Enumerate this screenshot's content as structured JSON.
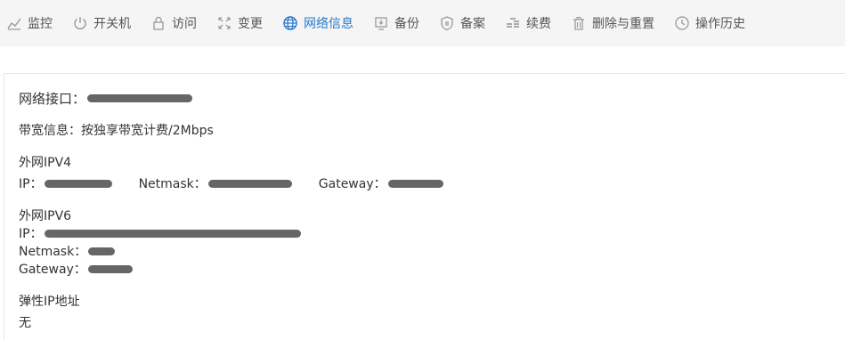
{
  "tabs": [
    {
      "id": "monitor",
      "label": "监控",
      "icon": "chart-line-icon"
    },
    {
      "id": "power",
      "label": "开关机",
      "icon": "power-icon"
    },
    {
      "id": "access",
      "label": "访问",
      "icon": "lock-icon"
    },
    {
      "id": "change",
      "label": "变更",
      "icon": "resize-icon"
    },
    {
      "id": "network",
      "label": "网络信息",
      "icon": "globe-icon",
      "active": true
    },
    {
      "id": "backup",
      "label": "备份",
      "icon": "backup-icon"
    },
    {
      "id": "record",
      "label": "备案",
      "icon": "shield-icon"
    },
    {
      "id": "renew",
      "label": "续费",
      "icon": "coins-icon"
    },
    {
      "id": "delete",
      "label": "删除与重置",
      "icon": "trash-icon"
    },
    {
      "id": "history",
      "label": "操作历史",
      "icon": "clock-icon"
    }
  ],
  "network": {
    "interface_label": "网络接口：",
    "bandwidth_text": "带宽信息：按独享带宽计费/2Mbps",
    "ipv4_heading": "外网IPV4",
    "ipv4_ip_label": "IP：",
    "ipv4_netmask_label": "Netmask：",
    "ipv4_gateway_label": "Gateway：",
    "ipv6_heading": "外网IPV6",
    "ipv6_ip_label": "IP：",
    "ipv6_netmask_label": "Netmask：",
    "ipv6_gateway_label": "Gateway：",
    "eip_heading": "弹性IP地址",
    "eip_value": "无"
  },
  "colors": {
    "active_tab": "#2a79c9",
    "topbar_bg": "#f5f5f5",
    "redaction": "#666666"
  }
}
